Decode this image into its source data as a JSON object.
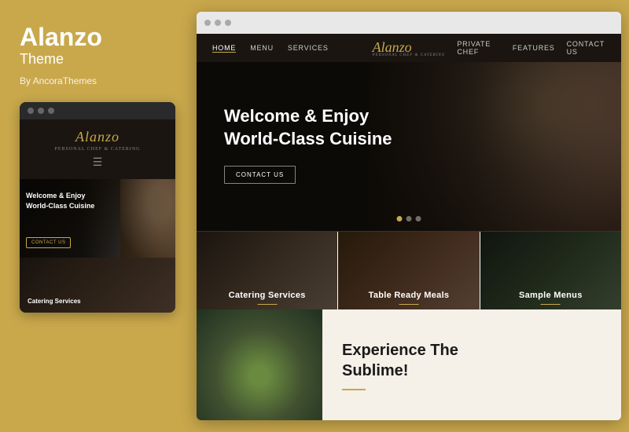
{
  "left": {
    "title": "Alanzo",
    "subtitle": "Theme",
    "by_line": "By AncoraThemes",
    "mobile": {
      "logo": "Alanzo",
      "tagline": "PERSONAL CHEF & CATERING",
      "hero_title": "Welcome & Enjoy\nWorld-Class Cuisine",
      "hero_btn": "CONTACT US",
      "service_label": "Catering Services"
    }
  },
  "browser": {
    "nav": {
      "links_left": [
        "HOME",
        "MENU",
        "SERVICES"
      ],
      "logo": "Alanzo",
      "logo_tag": "PERSONAL CHEF & CATERING",
      "links_right": [
        "PRIVATE CHEF",
        "FEATURES",
        "CONTACT US"
      ]
    },
    "hero": {
      "title": "Welcome & Enjoy\nWorld-Class Cuisine",
      "btn": "CONTACT US",
      "dots": [
        true,
        false,
        false
      ]
    },
    "services": [
      {
        "label": "Catering Services"
      },
      {
        "label": "Table Ready Meals"
      },
      {
        "label": "Sample Menus"
      }
    ],
    "sublime": {
      "title": "Experience The\nSublime!"
    }
  },
  "colors": {
    "gold": "#c9a84c",
    "dark": "#1a1510",
    "cream": "#f5f0e8"
  }
}
